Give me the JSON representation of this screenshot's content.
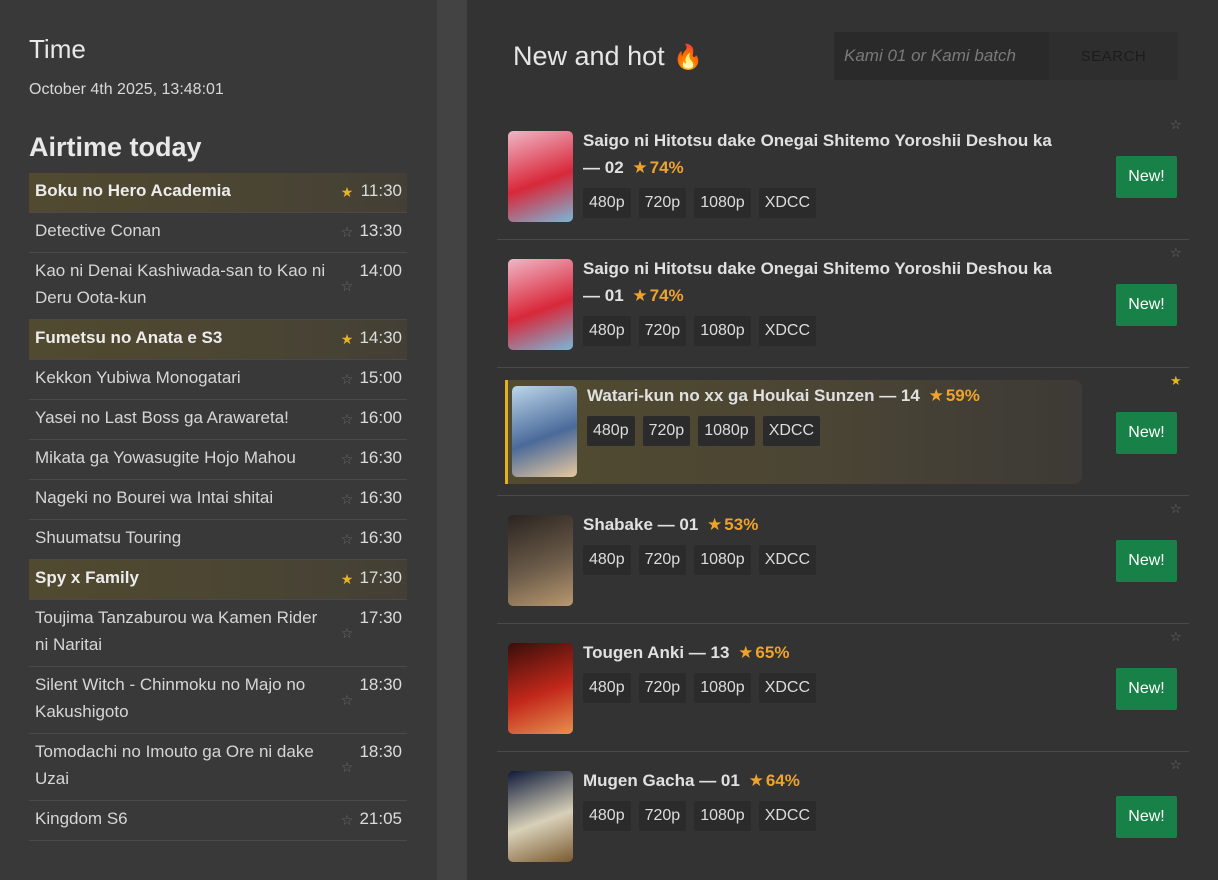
{
  "sidebar": {
    "time_heading": "Time",
    "clock": "October 4th 2025, 13:48:01",
    "airtime_heading": "Airtime today",
    "airtime": [
      {
        "title": "Boku no Hero Academia",
        "time": "11:30",
        "fav": true
      },
      {
        "title": "Detective Conan",
        "time": "13:30",
        "fav": false
      },
      {
        "title": "Kao ni Denai Kashiwada-san to Kao ni Deru Oota-kun",
        "time": "14:00",
        "fav": false
      },
      {
        "title": "Fumetsu no Anata e S3",
        "time": "14:30",
        "fav": true
      },
      {
        "title": "Kekkon Yubiwa Monogatari",
        "time": "15:00",
        "fav": false
      },
      {
        "title": "Yasei no Last Boss ga Arawareta!",
        "time": "16:00",
        "fav": false
      },
      {
        "title": "Mikata ga Yowasugite Hojo Mahou",
        "time": "16:30",
        "fav": false
      },
      {
        "title": "Nageki no Bourei wa Intai shitai",
        "time": "16:30",
        "fav": false
      },
      {
        "title": "Shuumatsu Touring",
        "time": "16:30",
        "fav": false
      },
      {
        "title": "Spy x Family",
        "time": "17:30",
        "fav": true
      },
      {
        "title": "Toujima Tanzaburou wa Kamen Rider ni Naritai",
        "time": "17:30",
        "fav": false
      },
      {
        "title": "Silent Witch - Chinmoku no Majo no Kakushigoto",
        "time": "18:30",
        "fav": false
      },
      {
        "title": "Tomodachi no Imouto ga Ore ni dake Uzai",
        "time": "18:30",
        "fav": false
      },
      {
        "title": "Kingdom S6",
        "time": "21:05",
        "fav": false
      }
    ],
    "star_glyph": "★",
    "empty_star_glyph": "☆"
  },
  "main": {
    "title": "New and hot",
    "title_icon": "fire-icon",
    "search": {
      "placeholder": "Kami 01 or Kami batch",
      "button_label": "SEARCH"
    },
    "new_label": "New!",
    "tags": [
      "480p",
      "720p",
      "1080p",
      "XDCC"
    ],
    "items": [
      {
        "title": "Saigo ni Hitotsu dake Onegai Shitemo Yoroshii Deshou ka",
        "episode": "02",
        "rating": "74%",
        "fav": false,
        "colors": [
          "#f0b6c6",
          "#d8283a",
          "#7ab8d8"
        ]
      },
      {
        "title": "Saigo ni Hitotsu dake Onegai Shitemo Yoroshii Deshou ka",
        "episode": "01",
        "rating": "74%",
        "fav": false,
        "colors": [
          "#f0b6c6",
          "#d8283a",
          "#7ab8d8"
        ]
      },
      {
        "title": "Watari-kun no xx ga Houkai Sunzen",
        "episode": "14",
        "rating": "59%",
        "fav": true,
        "colors": [
          "#bcd6ea",
          "#4a6a9a",
          "#e8c8a0"
        ]
      },
      {
        "title": "Shabake",
        "episode": "01",
        "rating": "53%",
        "fav": false,
        "colors": [
          "#2a2420",
          "#6a5a48",
          "#b89870"
        ]
      },
      {
        "title": "Tougen Anki",
        "episode": "13",
        "rating": "65%",
        "fav": false,
        "colors": [
          "#3a0e0a",
          "#c2281a",
          "#e89050"
        ]
      },
      {
        "title": "Mugen Gacha",
        "episode": "01",
        "rating": "64%",
        "fav": false,
        "colors": [
          "#0e1a3a",
          "#d8d0b8",
          "#7a5a30"
        ]
      }
    ]
  },
  "colors": {
    "accent_gold": "#e6b425",
    "rating_orange": "#f0a32a",
    "new_green": "#178147"
  }
}
